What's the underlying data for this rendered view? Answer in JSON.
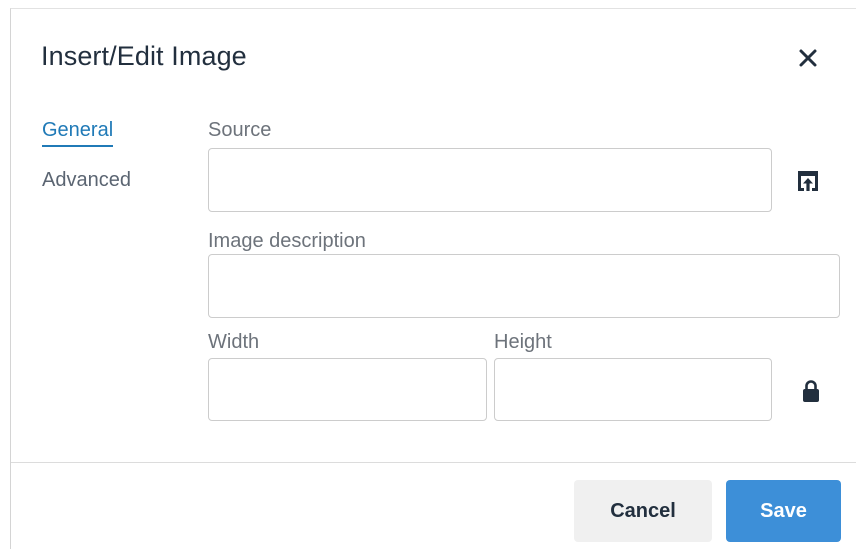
{
  "dialog": {
    "title": "Insert/Edit Image",
    "close_icon": "close-icon"
  },
  "tabs": [
    {
      "label": "General",
      "active": true
    },
    {
      "label": "Advanced",
      "active": false
    }
  ],
  "form": {
    "source": {
      "label": "Source",
      "value": "",
      "browse_icon": "upload-icon"
    },
    "description": {
      "label": "Image description",
      "value": ""
    },
    "width": {
      "label": "Width",
      "value": ""
    },
    "height": {
      "label": "Height",
      "value": ""
    },
    "constrain_icon": "lock-icon"
  },
  "footer": {
    "cancel_label": "Cancel",
    "save_label": "Save"
  },
  "colors": {
    "accent": "#207ab7",
    "save_button": "#3d8fd8",
    "cancel_button": "#f0f0f0",
    "text": "#222f3e"
  }
}
